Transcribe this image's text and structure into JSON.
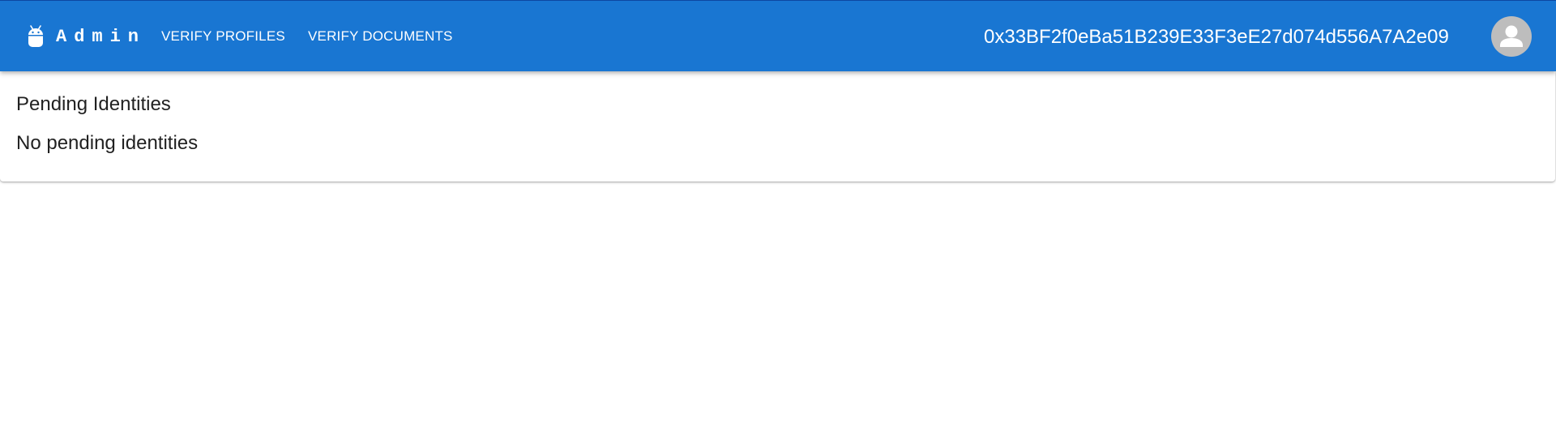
{
  "colors": {
    "appbar": "#1976d2",
    "appbar_text": "#ffffff",
    "avatar_bg": "#bdbdbd",
    "text_primary": "#212121"
  },
  "brand": {
    "icon": "android-icon",
    "title": "Admin"
  },
  "nav": {
    "items": [
      {
        "label": "VERIFY PROFILES"
      },
      {
        "label": "VERIFY DOCUMENTS"
      }
    ]
  },
  "account": {
    "address": "0x33BF2f0eBa51B239E33F3eE27d074d556A7A2e09",
    "avatar_icon": "person-icon"
  },
  "main": {
    "title": "Pending Identities",
    "empty_message": "No pending identities"
  }
}
